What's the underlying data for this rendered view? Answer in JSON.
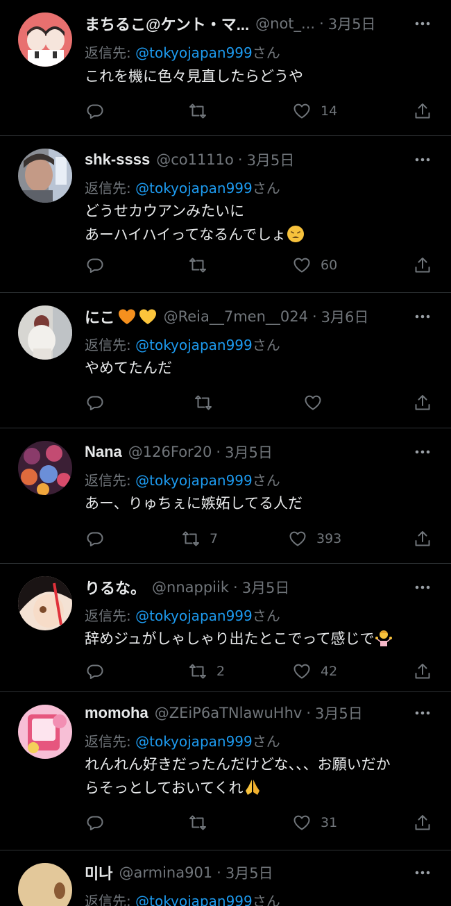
{
  "reply_prefix": "返信先:",
  "reply_suffix": "さん",
  "reply_mention": "@tokyojapan999",
  "colors": {
    "background": "#000000",
    "text": "#e7e9ea",
    "muted": "#71767b",
    "accent": "#1d9bf0",
    "divider": "#2f3336"
  },
  "tweets": [
    {
      "name": "まちるこ@ケント・マ...",
      "handle": "@not_...",
      "date": "3月5日",
      "lines": [
        "これを機に色々見直したらどうや"
      ],
      "reply_count": "",
      "retweet_count": "",
      "like_count": "14",
      "avatar_icon": "avatar-illustration-icon"
    },
    {
      "name": "shk-ssss",
      "handle": "@co1111o",
      "date": "3月5日",
      "lines": [
        "どうせカウアンみたいに",
        "あーハイハイってなるんでしょ"
      ],
      "trailing_emoji": "weary-face-emoji",
      "reply_count": "",
      "retweet_count": "",
      "like_count": "60",
      "avatar_icon": "avatar-photo-icon"
    },
    {
      "name": "にこ",
      "name_emoji": [
        "orange-heart-emoji",
        "yellow-heart-emoji"
      ],
      "handle": "@Reia__7men__024",
      "date": "3月6日",
      "lines": [
        "やめてたんだ"
      ],
      "reply_count": "",
      "retweet_count": "",
      "like_count": "",
      "avatar_icon": "avatar-photo-icon"
    },
    {
      "name": "Nana",
      "handle": "@126For20",
      "date": "3月5日",
      "lines": [
        "あー、りゅちぇに嫉妬してる人だ"
      ],
      "reply_count": "",
      "retweet_count": "7",
      "like_count": "393",
      "avatar_icon": "avatar-collage-icon"
    },
    {
      "name": "りるな。",
      "handle": "@nnappiik",
      "date": "3月5日",
      "lines": [
        "辞めジュがしゃしゃり出たとこでって感じで"
      ],
      "trailing_emoji": "person-shrugging-emoji",
      "reply_count": "",
      "retweet_count": "2",
      "like_count": "42",
      "avatar_icon": "avatar-anime-icon"
    },
    {
      "name": "momoha",
      "handle": "@ZEiP6aTNlawuHhv",
      "date": "3月5日",
      "lines": [
        "れんれん好きだったんだけどな、、、お願いだか",
        "らそっとしておいてくれ"
      ],
      "trailing_emoji": "folded-hands-emoji",
      "reply_count": "",
      "retweet_count": "",
      "like_count": "31",
      "avatar_icon": "avatar-pink-icon"
    },
    {
      "name": "미나",
      "handle": "@armina901",
      "date": "3月5日",
      "lines": [],
      "reply_count": "",
      "retweet_count": "",
      "like_count": "",
      "avatar_icon": "avatar-beige-icon"
    }
  ]
}
